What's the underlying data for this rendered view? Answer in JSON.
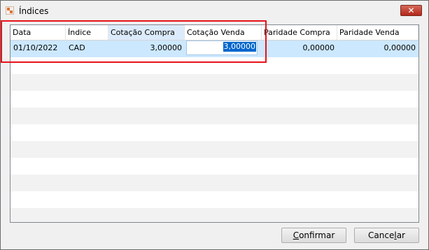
{
  "window": {
    "title": "Índices",
    "close_symbol": "✕"
  },
  "grid": {
    "columns": [
      "Data",
      "Índice",
      "Cotação Compra",
      "Cotação Venda",
      "Paridade Compra",
      "Paridade Venda"
    ],
    "selected_column_index": 2,
    "rows": [
      {
        "data": "01/10/2022",
        "indice": "CAD",
        "cotacao_compra": "3,00000",
        "cotacao_venda": "3,00000",
        "paridade_compra": "0,00000",
        "paridade_venda": "0,00000"
      }
    ],
    "editing_value": "3,00000"
  },
  "buttons": {
    "confirm": {
      "underlined": "C",
      "rest": "onfirmar"
    },
    "cancel": {
      "prefix": "Cance",
      "underlined": "l",
      "rest": "ar"
    }
  },
  "colors": {
    "selected_row": "#cce8ff",
    "alt_row": "#f2f2f2",
    "highlight_box": "#e8121b",
    "edit_selection": "#0066cc"
  }
}
